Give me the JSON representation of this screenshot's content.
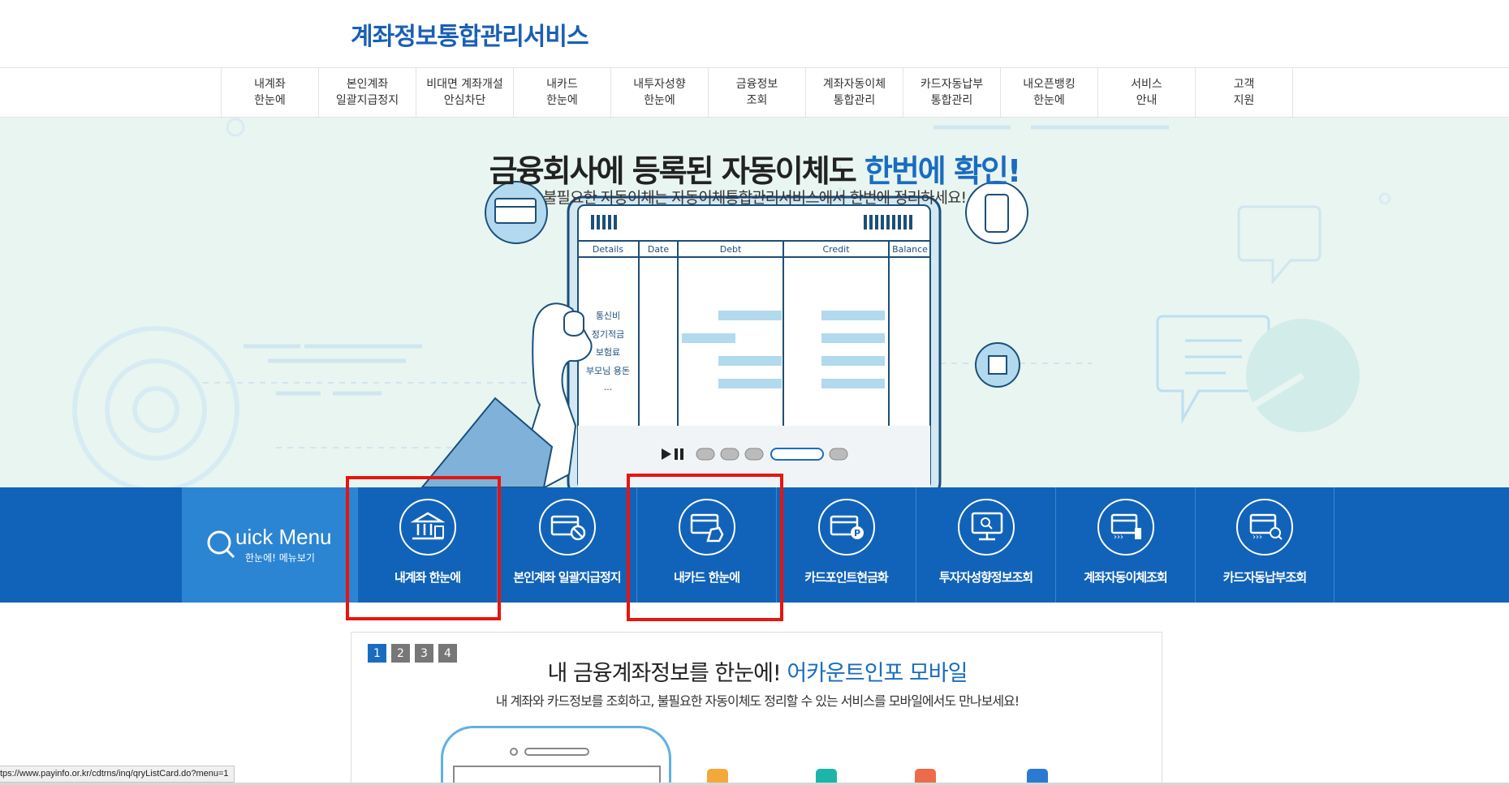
{
  "header": {
    "logo": "계좌정보통합관리서비스"
  },
  "gnb": [
    {
      "line1": "내계좌",
      "line2": "한눈에"
    },
    {
      "line1": "본인계좌",
      "line2": "일괄지급정지"
    },
    {
      "line1": "비대면 계좌개설",
      "line2": "안심차단"
    },
    {
      "line1": "내카드",
      "line2": "한눈에"
    },
    {
      "line1": "내투자성향",
      "line2": "한눈에"
    },
    {
      "line1": "금융정보",
      "line2": "조회"
    },
    {
      "line1": "계좌자동이체",
      "line2": "통합관리"
    },
    {
      "line1": "카드자동납부",
      "line2": "통합관리"
    },
    {
      "line1": "내오픈뱅킹",
      "line2": "한눈에"
    },
    {
      "line1": "서비스",
      "line2": "안내"
    },
    {
      "line1": "고객",
      "line2": "지원"
    }
  ],
  "hero": {
    "title_main": "금융회사에 등록된 자동이체도 ",
    "title_highlight": "한번에 확인!",
    "subtitle": "불필요한 자동이체는 자동이체통합관리서비스에서 한번에 정리하세요!",
    "table_headers": [
      "Details",
      "Date",
      "Debt",
      "Credit",
      "Balance"
    ],
    "table_rows": [
      "통신비",
      "정기적금",
      "보험료",
      "부모님 용돈",
      "..."
    ]
  },
  "quick_menu": {
    "title": "uick Menu",
    "subtitle": "한눈에! 메뉴보기",
    "items": [
      {
        "label": "내계좌 한눈에",
        "icon": "bank-icon"
      },
      {
        "label": "본인계좌 일괄지급정지",
        "icon": "card-block-icon"
      },
      {
        "label": "내카드 한눈에",
        "icon": "card-hand-icon"
      },
      {
        "label": "카드포인트현금화",
        "icon": "card-point-icon"
      },
      {
        "label": "투자자성향정보조회",
        "icon": "monitor-search-icon"
      },
      {
        "label": "계좌자동이체조회",
        "icon": "account-transfer-icon"
      },
      {
        "label": "카드자동납부조회",
        "icon": "card-search-icon"
      }
    ]
  },
  "panel": {
    "pages": [
      "1",
      "2",
      "3",
      "4"
    ],
    "active_page": "1",
    "title_main": "내 금융계좌정보를 한눈에! ",
    "title_highlight": "어카운트인포 모바일",
    "subtitle": "내 계좌와 카드정보를 조회하고, 불필요한 자동이체도 정리할 수 있는 서비스를 모바일에서도 만나보세요!"
  },
  "status_bar": {
    "url": "tps://www.payinfo.or.kr/cdtrns/inq/qryListCard.do?menu=1"
  },
  "colors": {
    "brand_blue": "#1163b9",
    "accent_blue": "#1a6cc0",
    "hero_bg": "#e9f5f1",
    "highlight_red": "#e8140f"
  }
}
